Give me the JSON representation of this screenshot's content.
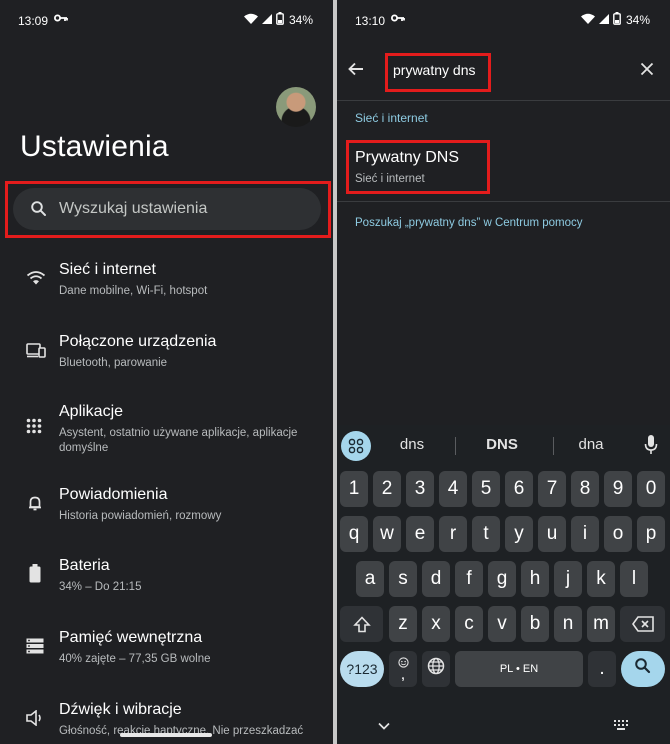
{
  "left_screen": {
    "status": {
      "time": "13:09",
      "battery": "34%"
    },
    "title": "Ustawienia",
    "search_placeholder": "Wyszukaj ustawienia",
    "items": [
      {
        "title": "Sieć i internet",
        "subtitle": "Dane mobilne, Wi-Fi, hotspot",
        "icon": "wifi-icon"
      },
      {
        "title": "Połączone urządzenia",
        "subtitle": "Bluetooth, parowanie",
        "icon": "connected-devices-icon"
      },
      {
        "title": "Aplikacje",
        "subtitle": "Asystent, ostatnio używane aplikacje, aplikacje domyślne",
        "icon": "apps-grid-icon"
      },
      {
        "title": "Powiadomienia",
        "subtitle": "Historia powiadomień, rozmowy",
        "icon": "bell-icon"
      },
      {
        "title": "Bateria",
        "subtitle": "34% – Do 21:15",
        "icon": "battery-icon"
      },
      {
        "title": "Pamięć wewnętrzna",
        "subtitle": "40% zajęte – 77,35 GB wolne",
        "icon": "storage-icon"
      },
      {
        "title": "Dźwięk i wibracje",
        "subtitle": "Głośność, reakcje haptyczne, Nie przeszkadzać",
        "icon": "sound-icon"
      }
    ]
  },
  "right_screen": {
    "status": {
      "time": "13:10",
      "battery": "34%"
    },
    "query": "prywatny dns",
    "section_label": "Sieć i internet",
    "result": {
      "title": "Prywatny DNS",
      "subtitle": "Sieć i internet"
    },
    "help_link": "Poszukaj „prywatny dns” w Centrum pomocy",
    "keyboard": {
      "suggestions": [
        "dns",
        "DNS",
        "dna"
      ],
      "row_numbers": [
        "1",
        "2",
        "3",
        "4",
        "5",
        "6",
        "7",
        "8",
        "9",
        "0"
      ],
      "row1": [
        "q",
        "w",
        "e",
        "r",
        "t",
        "y",
        "u",
        "i",
        "o",
        "p"
      ],
      "row2": [
        "a",
        "s",
        "d",
        "f",
        "g",
        "h",
        "j",
        "k",
        "l"
      ],
      "row3": [
        "z",
        "x",
        "c",
        "v",
        "b",
        "n",
        "m"
      ],
      "sym_label": "?123",
      "comma_label": ",",
      "space_label": "PL • EN",
      "period_label": "."
    }
  },
  "colors": {
    "highlight": "#e31c1c",
    "accent": "#8ecbe2",
    "background": "#1f2023"
  }
}
